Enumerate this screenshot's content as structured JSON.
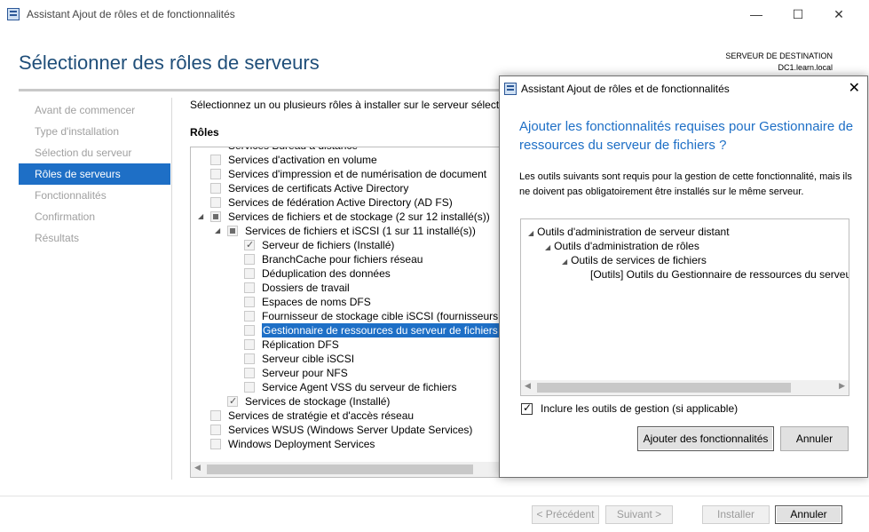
{
  "window": {
    "title": "Assistant Ajout de rôles et de fonctionnalités",
    "minimize": "—",
    "maximize": "☐",
    "close": "✕"
  },
  "page": {
    "title": "Sélectionner des rôles de serveurs",
    "destination_label": "SERVEUR DE DESTINATION",
    "destination_server": "DC1.learn.local",
    "instruction": "Sélectionnez un ou plusieurs rôles à installer sur le serveur sélectionné.",
    "roles_label": "Rôles"
  },
  "nav": {
    "items": [
      {
        "label": "Avant de commencer"
      },
      {
        "label": "Type d'installation"
      },
      {
        "label": "Sélection du serveur"
      },
      {
        "label": "Rôles de serveurs"
      },
      {
        "label": "Fonctionnalités"
      },
      {
        "label": "Confirmation"
      },
      {
        "label": "Résultats"
      }
    ]
  },
  "roles": [
    {
      "label": "Services Bureau à distance",
      "checkbox": "unchecked"
    },
    {
      "label": "Services d'activation en volume",
      "checkbox": "unchecked"
    },
    {
      "label": "Services d'impression et de numérisation de document",
      "checkbox": "unchecked"
    },
    {
      "label": "Services de certificats Active Directory",
      "checkbox": "unchecked"
    },
    {
      "label": "Services de fédération Active Directory (AD FS)",
      "checkbox": "unchecked"
    },
    {
      "label": "Services de fichiers et de stockage (2 sur 12 installé(s))",
      "checkbox": "partial"
    },
    {
      "label": "Services de fichiers et iSCSI (1 sur 11 installé(s))",
      "checkbox": "partial"
    },
    {
      "label": "Serveur de fichiers (Installé)",
      "checkbox": "checked"
    },
    {
      "label": "BranchCache pour fichiers réseau",
      "checkbox": "unchecked"
    },
    {
      "label": "Déduplication des données",
      "checkbox": "unchecked"
    },
    {
      "label": "Dossiers de travail",
      "checkbox": "unchecked"
    },
    {
      "label": "Espaces de noms DFS",
      "checkbox": "unchecked"
    },
    {
      "label": "Fournisseur de stockage cible iSCSI (fournisseurs d",
      "checkbox": "unchecked"
    },
    {
      "label": "Gestionnaire de ressources du serveur de fichiers",
      "checkbox": "unchecked",
      "selected": true
    },
    {
      "label": "Réplication DFS",
      "checkbox": "unchecked"
    },
    {
      "label": "Serveur cible iSCSI",
      "checkbox": "unchecked"
    },
    {
      "label": "Serveur pour NFS",
      "checkbox": "unchecked"
    },
    {
      "label": "Service Agent VSS du serveur de fichiers",
      "checkbox": "unchecked"
    },
    {
      "label": "Services de stockage (Installé)",
      "checkbox": "checked"
    },
    {
      "label": "Services de stratégie et d'accès réseau",
      "checkbox": "unchecked"
    },
    {
      "label": "Services WSUS (Windows Server Update Services)",
      "checkbox": "unchecked"
    },
    {
      "label": "Windows Deployment Services",
      "checkbox": "unchecked"
    }
  ],
  "buttons": {
    "previous": "< Précédent",
    "next": "Suivant >",
    "install": "Installer",
    "cancel": "Annuler"
  },
  "dialog": {
    "title": "Assistant Ajout de rôles et de fonctionnalités",
    "close": "✕",
    "heading": "Ajouter les fonctionnalités requises pour Gestionnaire de ressources du serveur de fichiers ?",
    "description": "Les outils suivants sont requis pour la gestion de cette fonctionnalité, mais ils ne doivent pas obligatoirement être installés sur le même serveur.",
    "tree": [
      {
        "label": "Outils d'administration de serveur distant",
        "expander": "◢"
      },
      {
        "label": "Outils d'administration de rôles",
        "expander": "◢"
      },
      {
        "label": "Outils de services de fichiers",
        "expander": "◢"
      },
      {
        "label": "[Outils] Outils du Gestionnaire de ressources du serveur de fichiers",
        "expander": ""
      }
    ],
    "include_tools_label": "Inclure les outils de gestion (si applicable)",
    "add_button": "Ajouter des fonctionnalités",
    "cancel_button": "Annuler"
  },
  "colors": {
    "accent": "#1e6fc6",
    "title_blue": "#1f4e79"
  }
}
